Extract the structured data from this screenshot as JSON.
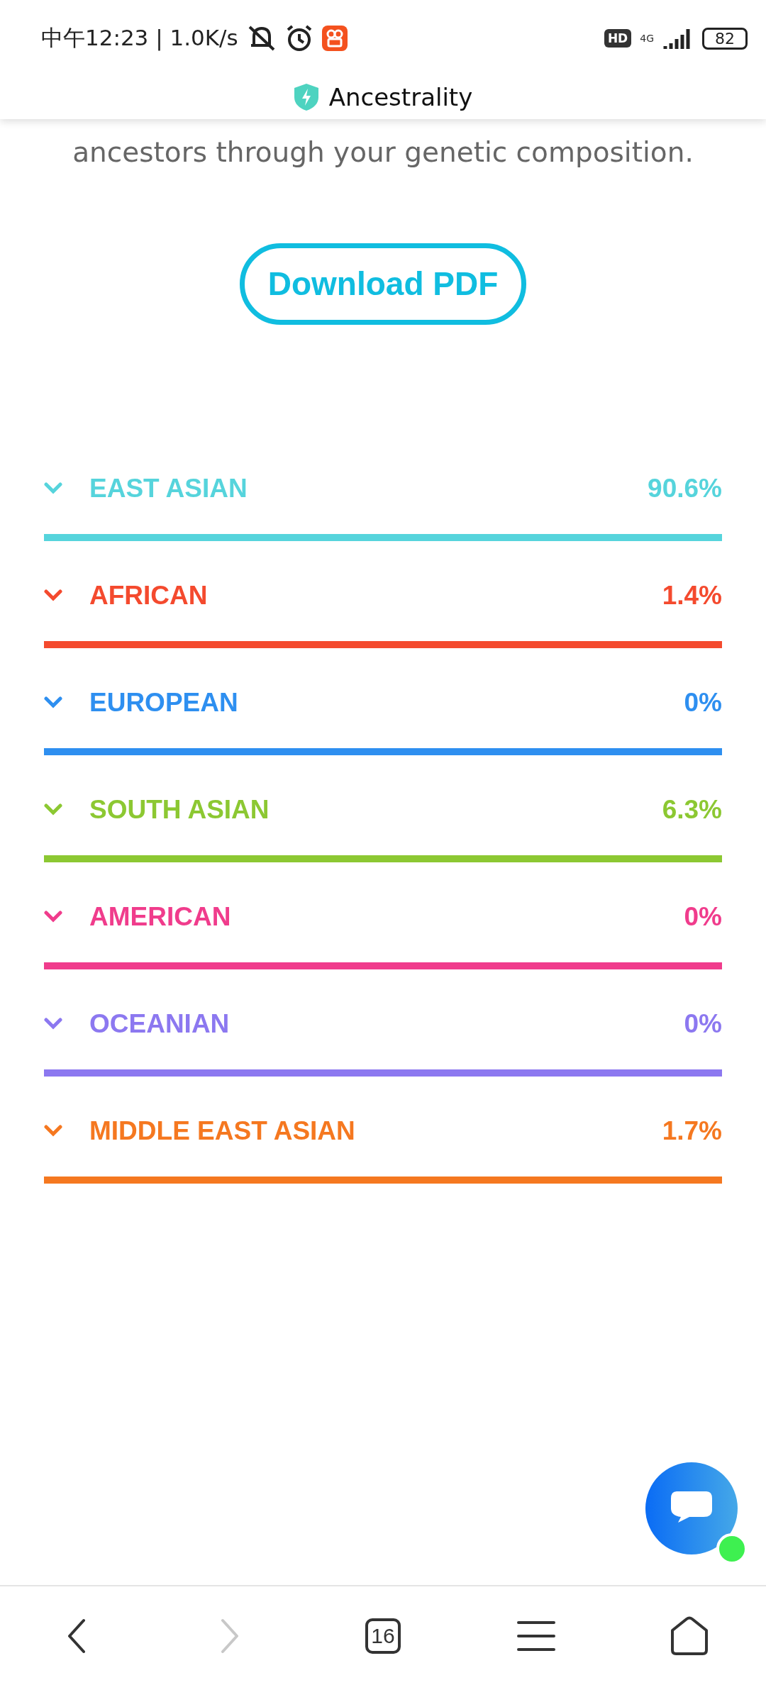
{
  "status_bar": {
    "time": "中午12:23 | 1.0K/s",
    "hd": "HD",
    "network": "4G",
    "battery": "82"
  },
  "header": {
    "title": "Ancestrality"
  },
  "intro": "ancestors through your genetic composition.",
  "download_button": "Download PDF",
  "ancestries": [
    {
      "name": "EAST ASIAN",
      "percent": "90.6%",
      "color": "#56d4dc",
      "expanded": false
    },
    {
      "name": "AFRICAN",
      "percent": "1.4%",
      "color": "#f44a2e",
      "expanded": false
    },
    {
      "name": "EUROPEAN",
      "percent": "0%",
      "color": "#2e8ff0",
      "expanded": false
    },
    {
      "name": "SOUTH ASIAN",
      "percent": "6.3%",
      "color": "#8cc832",
      "expanded": false
    },
    {
      "name": "AMERICAN",
      "percent": "0%",
      "color": "#f03c8c",
      "expanded": false
    },
    {
      "name": "OCEANIAN",
      "percent": "0%",
      "color": "#8c78f0",
      "expanded": false
    },
    {
      "name": "MIDDLE EAST ASIAN",
      "percent": "1.7%",
      "color": "#f57820",
      "expanded": false
    }
  ],
  "chat": {
    "online": true
  },
  "nav": [
    {
      "kind": "back",
      "disabled": false
    },
    {
      "kind": "forward",
      "disabled": true
    },
    {
      "kind": "tabs",
      "label": "16",
      "disabled": false
    },
    {
      "kind": "menu",
      "disabled": false
    },
    {
      "kind": "home",
      "disabled": false
    }
  ]
}
